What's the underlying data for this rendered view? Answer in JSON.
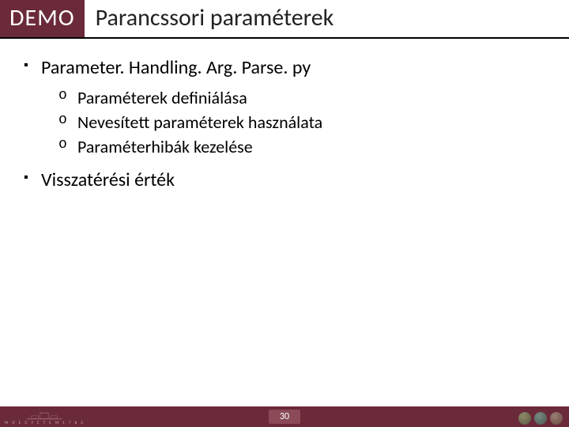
{
  "header": {
    "badge": "DEMO",
    "title": "Parancssori paraméterek"
  },
  "content": {
    "items": [
      {
        "label": "Parameter. Handling. Arg. Parse. py",
        "sub": [
          "Paraméterek definiálása",
          "Nevesített paraméterek használata",
          "Paraméterhibák kezelése"
        ]
      },
      {
        "label": "Visszatérési érték",
        "sub": []
      }
    ]
  },
  "footer": {
    "page": "30",
    "uni": "M Ű E G Y E T E M  1 7 8 2"
  }
}
